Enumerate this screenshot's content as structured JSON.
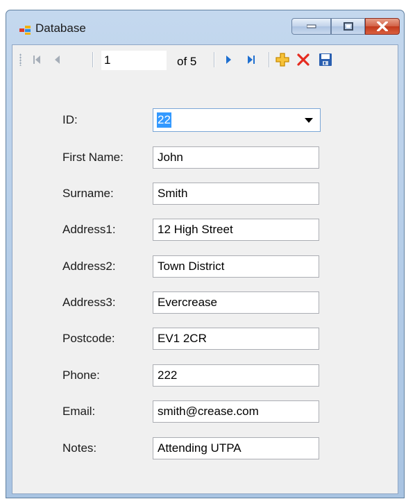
{
  "window": {
    "title": "Database"
  },
  "navigator": {
    "position": "1",
    "of_label": "of 5"
  },
  "form": {
    "fields": [
      {
        "label": "ID:",
        "value": "22"
      },
      {
        "label": "First Name:",
        "value": "John"
      },
      {
        "label": "Surname:",
        "value": "Smith"
      },
      {
        "label": "Address1:",
        "value": "12 High Street"
      },
      {
        "label": "Address2:",
        "value": "Town District"
      },
      {
        "label": "Address3:",
        "value": "Evercrease"
      },
      {
        "label": "Postcode:",
        "value": "EV1 2CR"
      },
      {
        "label": "Phone:",
        "value": "222"
      },
      {
        "label": "Email:",
        "value": "smith@crease.com"
      },
      {
        "label": "Notes:",
        "value": "Attending UTPA"
      }
    ]
  },
  "icons": {
    "app": "app-icon",
    "first": "move-first-icon",
    "previous": "move-previous-icon",
    "next": "move-next-icon",
    "last": "move-last-icon",
    "add": "add-new-icon",
    "delete": "delete-icon",
    "save": "save-icon"
  },
  "colors": {
    "selection": "#3399ff",
    "nav_arrow": "#1e6fd0",
    "add": "#f0b000",
    "delete": "#e52b1f",
    "save": "#2a5fb0"
  }
}
